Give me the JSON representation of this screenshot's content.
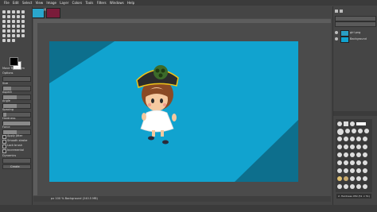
{
  "menubar": {
    "items": [
      "File",
      "Edit",
      "Select",
      "View",
      "Image",
      "Layer",
      "Colors",
      "Tools",
      "Filters",
      "Windows",
      "Help"
    ]
  },
  "tool_options": {
    "title": "Move Transform",
    "size_label": "Size",
    "aspect_label": "Aspect",
    "angle_label": "Angle",
    "spacing_label": "Spacing",
    "hardness_label": "Hardness",
    "force_label": "Force",
    "jitter_label": "Apply Jitter",
    "smooth_label": "Smooth stroke",
    "lock_label": "Lock brush",
    "incremental_label": "Incremental",
    "dynamics_label": "Dynamics",
    "create_label": "Create",
    "options_label": "Options"
  },
  "status": {
    "text": "px  100 %  Background (240.5 MB)"
  },
  "layers": [
    {
      "name": "girl.png",
      "thumb_color": "#2a9fc4"
    },
    {
      "name": "Background",
      "thumb_color": "#11a3cf"
    }
  ],
  "brushes": {
    "label": "2. Hardness 050 (51 × 51)"
  },
  "colors": {
    "image_bg": "#11a3cf",
    "image_dark": "#0d6f8d",
    "ui_bg": "#454545"
  }
}
